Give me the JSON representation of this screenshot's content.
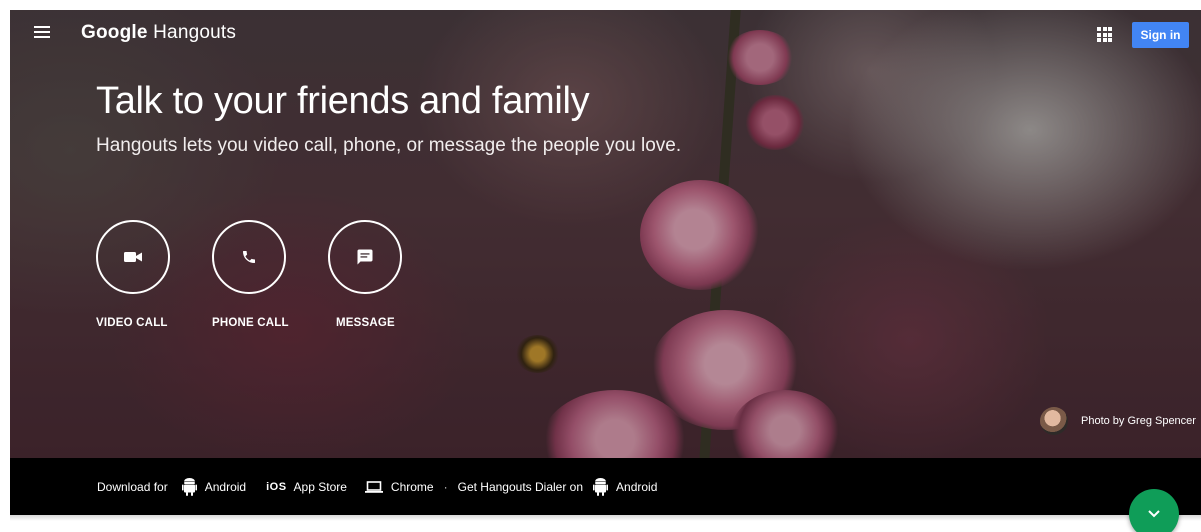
{
  "header": {
    "logo_google": "Google",
    "logo_product": "Hangouts",
    "signin_label": "Sign in"
  },
  "hero": {
    "headline": "Talk to your friends and family",
    "subhead": "Hangouts lets you video call, phone, or message the people you love."
  },
  "actions": [
    {
      "label": "VIDEO CALL",
      "icon": "videocam-icon"
    },
    {
      "label": "PHONE CALL",
      "icon": "phone-icon"
    },
    {
      "label": "MESSAGE",
      "icon": "message-icon"
    }
  ],
  "credit": {
    "text": "Photo by Greg Spencer"
  },
  "download": {
    "prefix": "Download for",
    "android": "Android",
    "ios_glyph": "iOS",
    "app_store": "App Store",
    "chrome": "Chrome",
    "separator": "·",
    "dialer_prefix": "Get Hangouts Dialer on",
    "dialer_android": "Android"
  },
  "colors": {
    "brand_blue": "#4285f4",
    "fab_green": "#0f9d58",
    "strip_black": "#000000"
  }
}
